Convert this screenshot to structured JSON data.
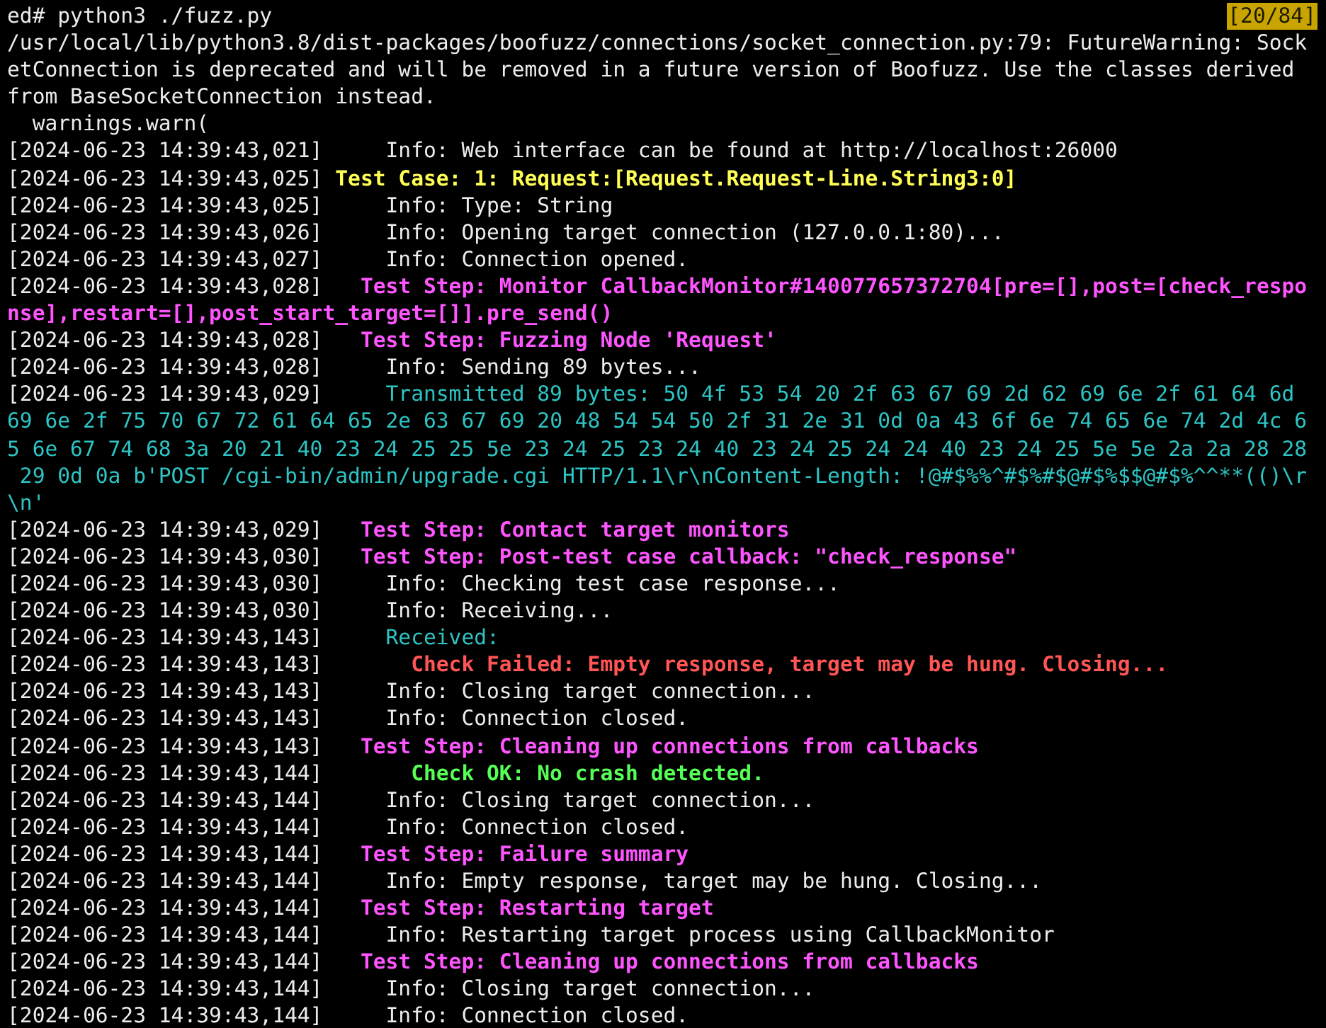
{
  "prompt": {
    "text": "ed# python3 ./fuzz.py",
    "badge": "[20/84]"
  },
  "lines": [
    {
      "kind": "plain",
      "message": "/usr/local/lib/python3.8/dist-packages/boofuzz/connections/socket_connection.py:79: FutureWarning: SocketConnection is deprecated and will be removed in a future version of Boofuzz. Use the classes derived from BaseSocketConnection instead."
    },
    {
      "kind": "traceback",
      "message": "warnings.warn("
    },
    {
      "kind": "info",
      "timestamp": "[2024-06-23 14:39:43,021]",
      "message": "Info: Web interface can be found at http://localhost:26000"
    },
    {
      "kind": "test_case",
      "timestamp": "[2024-06-23 14:39:43,025]",
      "message": "Test Case: 1: Request:[Request.Request-Line.String3:0]"
    },
    {
      "kind": "info",
      "timestamp": "[2024-06-23 14:39:43,025]",
      "message": "Info: Type: String"
    },
    {
      "kind": "info",
      "timestamp": "[2024-06-23 14:39:43,026]",
      "message": "Info: Opening target connection (127.0.0.1:80)..."
    },
    {
      "kind": "info",
      "timestamp": "[2024-06-23 14:39:43,027]",
      "message": "Info: Connection opened."
    },
    {
      "kind": "test_step",
      "timestamp": "[2024-06-23 14:39:43,028]",
      "message": "Test Step: Monitor CallbackMonitor#140077657372704[pre=[],post=[check_respo",
      "continuation": [
        "nse],restart=[],post_start_target=[]].pre_send()"
      ]
    },
    {
      "kind": "test_step",
      "timestamp": "[2024-06-23 14:39:43,028]",
      "message": "Test Step: Fuzzing Node 'Request'"
    },
    {
      "kind": "info",
      "timestamp": "[2024-06-23 14:39:43,028]",
      "message": "Info: Sending 89 bytes..."
    },
    {
      "kind": "transmitted",
      "timestamp": "[2024-06-23 14:39:43,029]",
      "message": "Transmitted 89 bytes: 50 4f 53 54 20 2f 63 67 69 2d 62 69 6e 2f 61 64 6d",
      "continuation": [
        "69 6e 2f 75 70 67 72 61 64 65 2e 63 67 69 20 48 54 54 50 2f 31 2e 31 0d 0a 43 6f 6e 74 65 6e 74 2d 4c 6",
        "5 6e 67 74 68 3a 20 21 40 23 24 25 25 5e 23 24 25 23 24 40 23 24 25 24 24 40 23 24 25 5e 5e 2a 2a 28 28",
        " 29 0d 0a b'POST /cgi-bin/admin/upgrade.cgi HTTP/1.1\\r\\nContent-Length: !@#$%%^#$%#$@#$%$$@#$%^^**(()\\r",
        "\\n'"
      ]
    },
    {
      "kind": "test_step",
      "timestamp": "[2024-06-23 14:39:43,029]",
      "message": "Test Step: Contact target monitors"
    },
    {
      "kind": "test_step",
      "timestamp": "[2024-06-23 14:39:43,030]",
      "message": "Test Step: Post-test case callback: \"check_response\""
    },
    {
      "kind": "info",
      "timestamp": "[2024-06-23 14:39:43,030]",
      "message": "Info: Checking test case response..."
    },
    {
      "kind": "info",
      "timestamp": "[2024-06-23 14:39:43,030]",
      "message": "Info: Receiving..."
    },
    {
      "kind": "received",
      "timestamp": "[2024-06-23 14:39:43,143]",
      "message": "Received:"
    },
    {
      "kind": "check_failed",
      "timestamp": "[2024-06-23 14:39:43,143]",
      "message": "Check Failed: Empty response, target may be hung. Closing..."
    },
    {
      "kind": "info",
      "timestamp": "[2024-06-23 14:39:43,143]",
      "message": "Info: Closing target connection..."
    },
    {
      "kind": "info",
      "timestamp": "[2024-06-23 14:39:43,143]",
      "message": "Info: Connection closed."
    },
    {
      "kind": "test_step",
      "timestamp": "[2024-06-23 14:39:43,143]",
      "message": "Test Step: Cleaning up connections from callbacks"
    },
    {
      "kind": "check_ok",
      "timestamp": "[2024-06-23 14:39:43,144]",
      "message": "Check OK: No crash detected."
    },
    {
      "kind": "info",
      "timestamp": "[2024-06-23 14:39:43,144]",
      "message": "Info: Closing target connection..."
    },
    {
      "kind": "info",
      "timestamp": "[2024-06-23 14:39:43,144]",
      "message": "Info: Connection closed."
    },
    {
      "kind": "test_step",
      "timestamp": "[2024-06-23 14:39:43,144]",
      "message": "Test Step: Failure summary"
    },
    {
      "kind": "info",
      "timestamp": "[2024-06-23 14:39:43,144]",
      "message": "Info: Empty response, target may be hung. Closing..."
    },
    {
      "kind": "test_step",
      "timestamp": "[2024-06-23 14:39:43,144]",
      "message": "Test Step: Restarting target"
    },
    {
      "kind": "info",
      "timestamp": "[2024-06-23 14:39:43,144]",
      "message": "Info: Restarting target process using CallbackMonitor"
    },
    {
      "kind": "test_step",
      "timestamp": "[2024-06-23 14:39:43,144]",
      "message": "Test Step: Cleaning up connections from callbacks"
    },
    {
      "kind": "info",
      "timestamp": "[2024-06-23 14:39:43,144]",
      "message": "Info: Closing target connection..."
    },
    {
      "kind": "info",
      "timestamp": "[2024-06-23 14:39:43,144]",
      "message": "Info: Connection closed."
    }
  ]
}
